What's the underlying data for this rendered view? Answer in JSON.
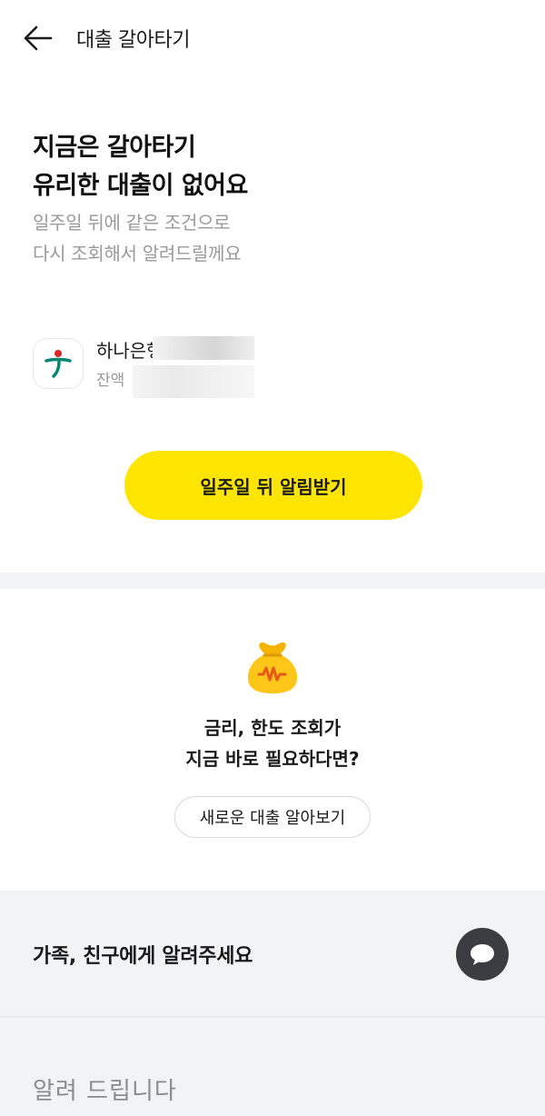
{
  "header": {
    "title": "대출 갈아타기",
    "back_icon": "arrow-left-icon"
  },
  "intro": {
    "headline_line1": "지금은 갈아타기",
    "headline_line2": "유리한 대출이 없어요",
    "sub_line1": "일주일 뒤에 같은 조건으로",
    "sub_line2": "다시 조회해서 알려드릴께요"
  },
  "loan": {
    "bank_name": "하나은행",
    "balance_label": "잔액",
    "logo_icon": "hana-bank-logo-icon"
  },
  "cta": {
    "notify_label": "일주일 뒤 알림받기",
    "color": "#fee500"
  },
  "explore": {
    "icon": "money-bag-icon",
    "line1": "금리, 한도 조회가",
    "line2": "지금 바로 필요하다면?",
    "button_label": "새로운 대출 알아보기"
  },
  "share": {
    "text": "가족, 친구에게 알려주세요",
    "icon": "chat-bubble-icon"
  },
  "notice": {
    "title": "알려 드립니다"
  }
}
